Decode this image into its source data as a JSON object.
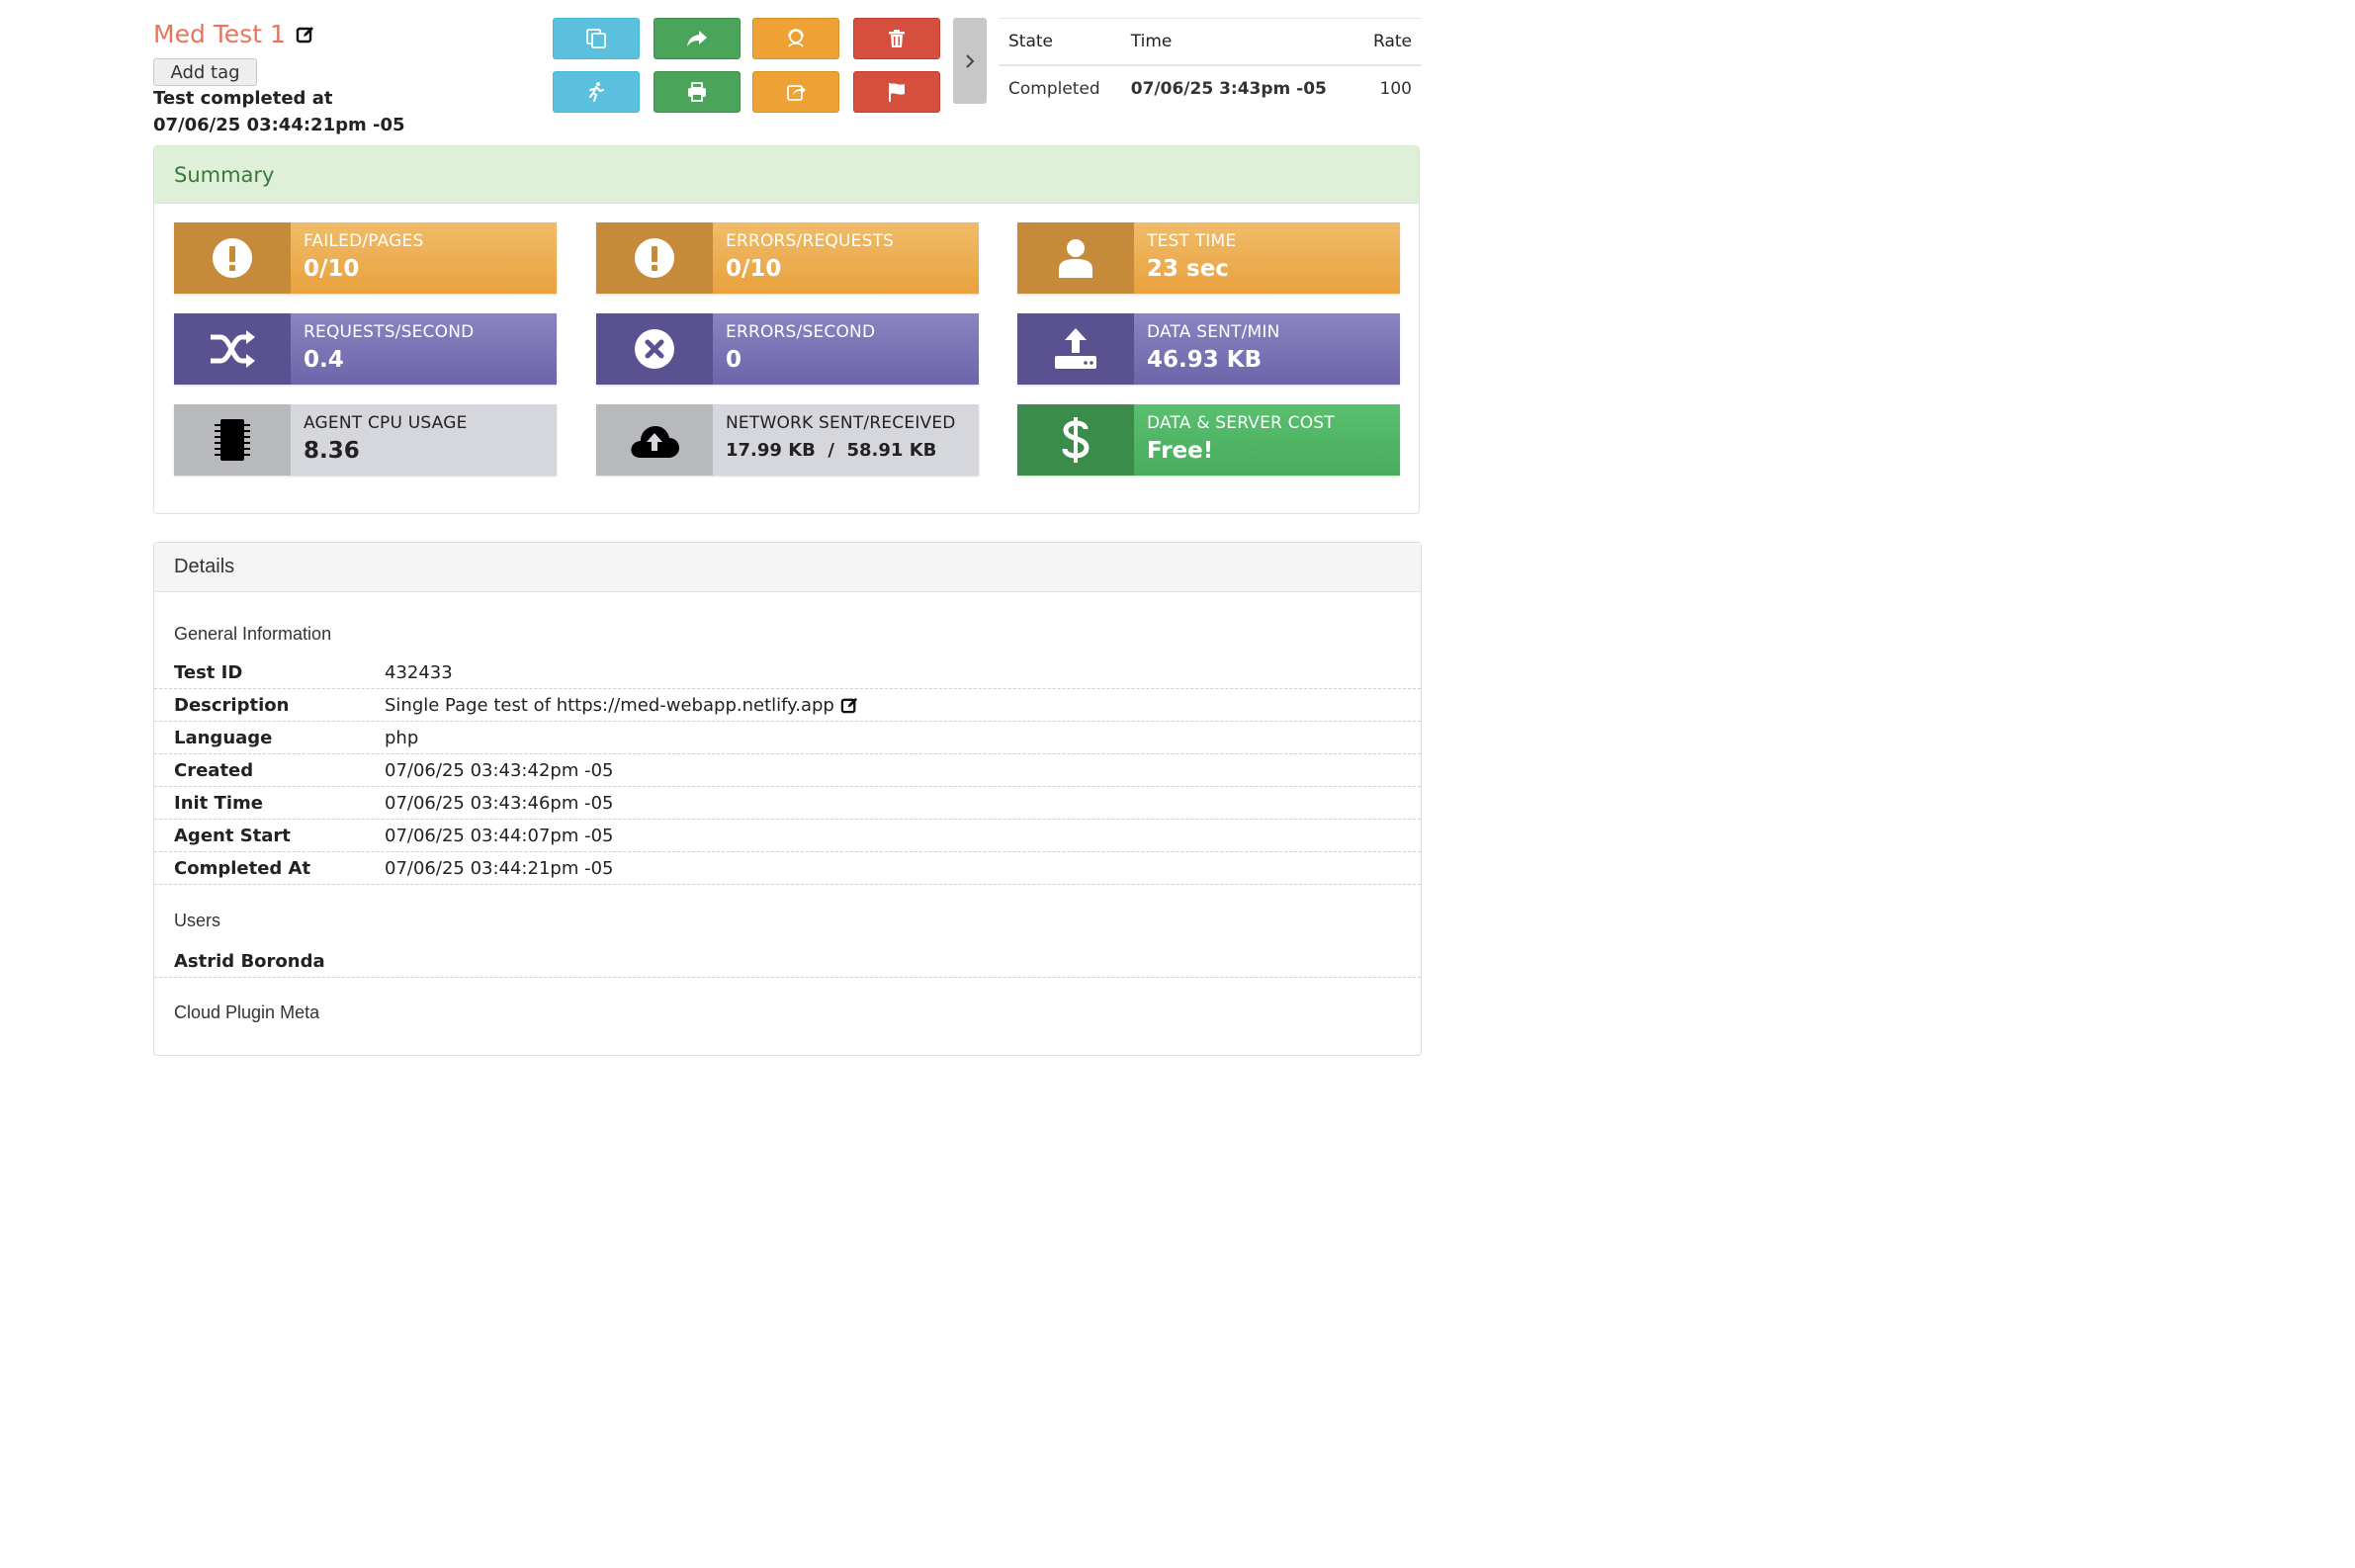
{
  "header": {
    "title": "Med Test 1",
    "add_tag_label": "Add tag",
    "completed_line1": "Test completed at",
    "completed_line2": "07/06/25 03:44:21pm -05"
  },
  "actions": [
    {
      "icon": "copy-icon",
      "color": "#5bc0de"
    },
    {
      "icon": "share-icon",
      "color": "#4aa55a"
    },
    {
      "icon": "support-agent-icon",
      "color": "#eea236"
    },
    {
      "icon": "trash-icon",
      "color": "#d64f3e"
    },
    {
      "icon": "running-person-icon",
      "color": "#5bc0de"
    },
    {
      "icon": "print-icon",
      "color": "#4aa55a"
    },
    {
      "icon": "export-icon",
      "color": "#eea236"
    },
    {
      "icon": "flag-icon",
      "color": "#d64f3e"
    }
  ],
  "state_table": {
    "headers": [
      "State",
      "Time",
      "Rate"
    ],
    "row": [
      "Completed",
      "07/06/25 3:43pm -05",
      "100"
    ]
  },
  "summary": {
    "title": "Summary",
    "tiles": [
      {
        "label": "FAILED/PAGES",
        "value": "0/10",
        "icon": "exclamation-icon",
        "color": "#e9a13d"
      },
      {
        "label": "ERRORS/REQUESTS",
        "value": "0/10",
        "icon": "exclamation-icon",
        "color": "#e9a13d"
      },
      {
        "label": "TEST TIME",
        "value": "23 sec",
        "icon": "user-icon",
        "color": "#e9a13d"
      },
      {
        "label": "REQUESTS/SECOND",
        "value": "0.4",
        "icon": "shuffle-icon",
        "color": "#6d65a8"
      },
      {
        "label": "ERRORS/SECOND",
        "value": "0",
        "icon": "times-circle-icon",
        "color": "#6d65a8"
      },
      {
        "label": "DATA SENT/MIN",
        "value": "46.93 KB",
        "icon": "upload-icon",
        "color": "#6d65a8"
      },
      {
        "label": "AGENT CPU USAGE",
        "value": "8.36",
        "icon": "cpu-chip-icon",
        "color": "#d5d7dc"
      },
      {
        "label": "NETWORK SENT/RECEIVED",
        "value": "17.99 KB  /  58.91 KB",
        "icon": "cloud-upload-icon",
        "color": "#d5d7dc"
      },
      {
        "label": "DATA & SERVER COST",
        "value": "Free!",
        "icon": "dollar-icon",
        "color": "#48ad5d"
      }
    ]
  },
  "details": {
    "title": "Details",
    "general_heading": "General Information",
    "rows": [
      {
        "key": "Test ID",
        "value": "432433"
      },
      {
        "key": "Description",
        "value": "Single Page test of https://med-webapp.netlify.app"
      },
      {
        "key": "Language",
        "value": "php"
      },
      {
        "key": "Created",
        "value": "07/06/25 03:43:42pm -05"
      },
      {
        "key": "Init Time",
        "value": "07/06/25 03:43:46pm -05"
      },
      {
        "key": "Agent Start",
        "value": "07/06/25 03:44:07pm -05"
      },
      {
        "key": "Completed At",
        "value": "07/06/25 03:44:21pm -05"
      }
    ],
    "users_heading": "Users",
    "users": [
      "Astrid Boronda"
    ],
    "cloud_heading": "Cloud Plugin Meta"
  }
}
